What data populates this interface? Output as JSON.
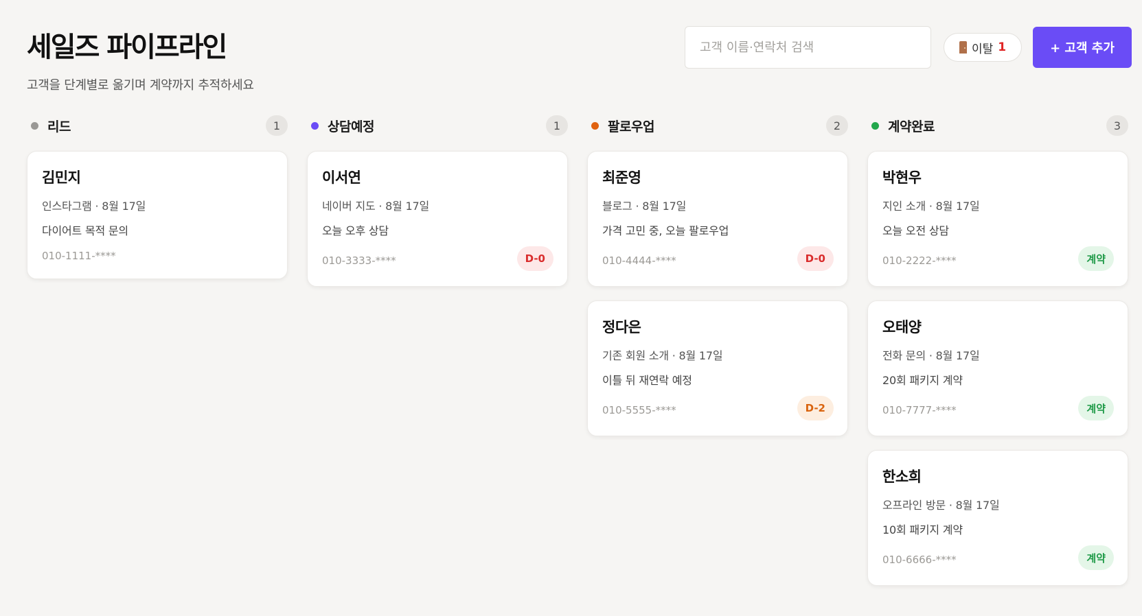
{
  "header": {
    "title": "세일즈 파이프라인",
    "subtitle": "고객을 단계별로 옮기며 계약까지 추적하세요",
    "search_placeholder": "고객 이름·연락처 검색",
    "churn_label": "이탈",
    "churn_count": "1",
    "churn_icon": "door-icon",
    "add_button": "+ 고객 추가"
  },
  "colors": {
    "accent": "#6a4cf6",
    "lead": "#9a9895",
    "scheduled": "#6a4cf6",
    "followup": "#e0620f",
    "closed": "#22a74b"
  },
  "columns": [
    {
      "title": "리드",
      "count": "1",
      "cards": [
        {
          "name": "김민지",
          "meta": "인스타그램 · 8월 17일",
          "note": "다이어트 목적 문의",
          "phone": "010-1111-****",
          "badge": ""
        }
      ]
    },
    {
      "title": "상담예정",
      "count": "1",
      "cards": [
        {
          "name": "이서연",
          "meta": "네이버 지도 · 8월 17일",
          "note": "오늘 오후 상담",
          "phone": "010-3333-****",
          "badge": "D-0"
        }
      ]
    },
    {
      "title": "팔로우업",
      "count": "2",
      "cards": [
        {
          "name": "최준영",
          "meta": "블로그 · 8월 17일",
          "note": "가격 고민 중, 오늘 팔로우업",
          "phone": "010-4444-****",
          "badge": "D-0"
        },
        {
          "name": "정다은",
          "meta": "기존 회원 소개 · 8월 17일",
          "note": "이틀 뒤 재연락 예정",
          "phone": "010-5555-****",
          "badge": "D-2"
        }
      ]
    },
    {
      "title": "계약완료",
      "count": "3",
      "cards": [
        {
          "name": "박현우",
          "meta": "지인 소개 · 8월 17일",
          "note": "오늘 오전 상담",
          "phone": "010-2222-****",
          "badge": "계약"
        },
        {
          "name": "오태양",
          "meta": "전화 문의 · 8월 17일",
          "note": "20회 패키지 계약",
          "phone": "010-7777-****",
          "badge": "계약"
        },
        {
          "name": "한소희",
          "meta": "오프라인 방문 · 8월 17일",
          "note": "10회 패키지 계약",
          "phone": "010-6666-****",
          "badge": "계약"
        }
      ]
    }
  ]
}
